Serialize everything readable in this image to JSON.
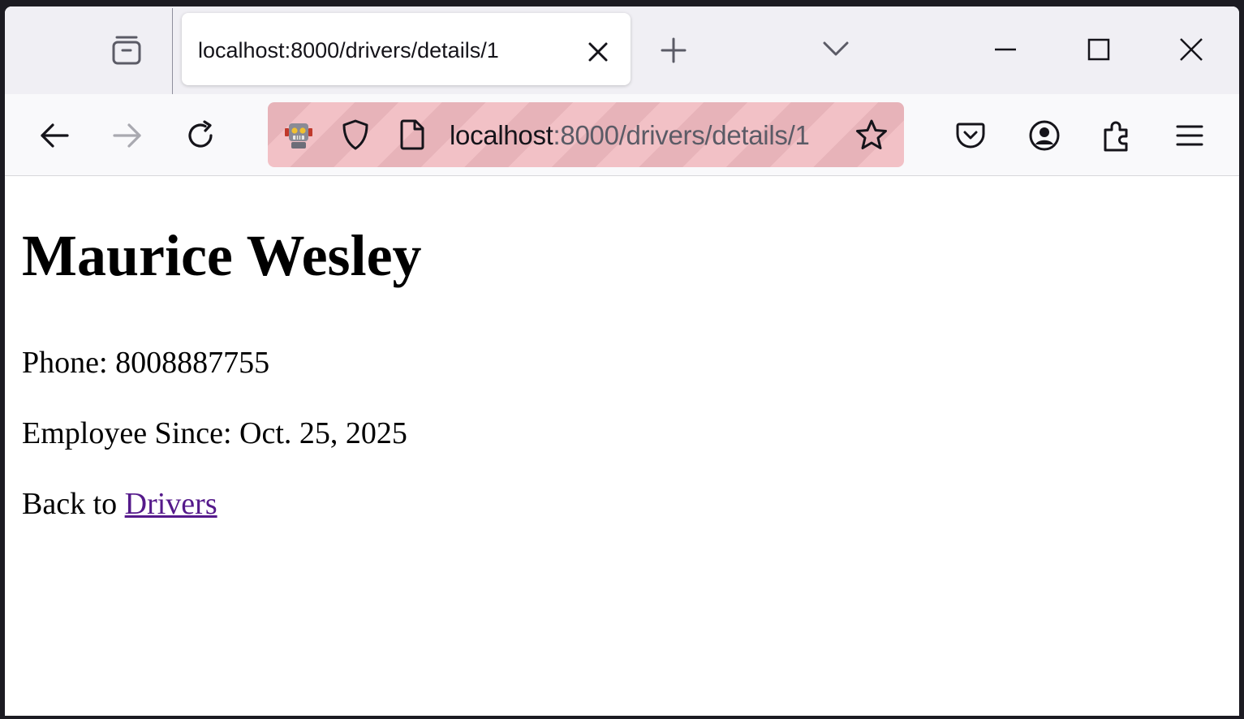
{
  "browser": {
    "tab": {
      "title": "localhost:8000/drivers/details/1"
    },
    "urlbar": {
      "host": "localhost",
      "path": ":8000/drivers/details/1"
    },
    "accent_colors": {
      "urlbar_bg": "#f2c1c6",
      "link_visited": "#551a8b"
    },
    "icons": [
      "tab-overview-icon",
      "close-icon",
      "plus-icon",
      "chevron-down-icon",
      "minimize-icon",
      "maximize-icon",
      "window-close-icon",
      "back-arrow-icon",
      "forward-arrow-icon",
      "reload-icon",
      "robot-icon",
      "shield-icon",
      "page-icon",
      "star-icon",
      "pocket-icon",
      "account-icon",
      "extensions-icon",
      "menu-icon"
    ]
  },
  "page": {
    "heading": "Maurice Wesley",
    "phone_label": "Phone:",
    "phone_value": "8008887755",
    "employee_since_label": "Employee Since:",
    "employee_since_value": "Oct. 25, 2025",
    "back_prefix": "Back to",
    "back_link": "Drivers"
  }
}
